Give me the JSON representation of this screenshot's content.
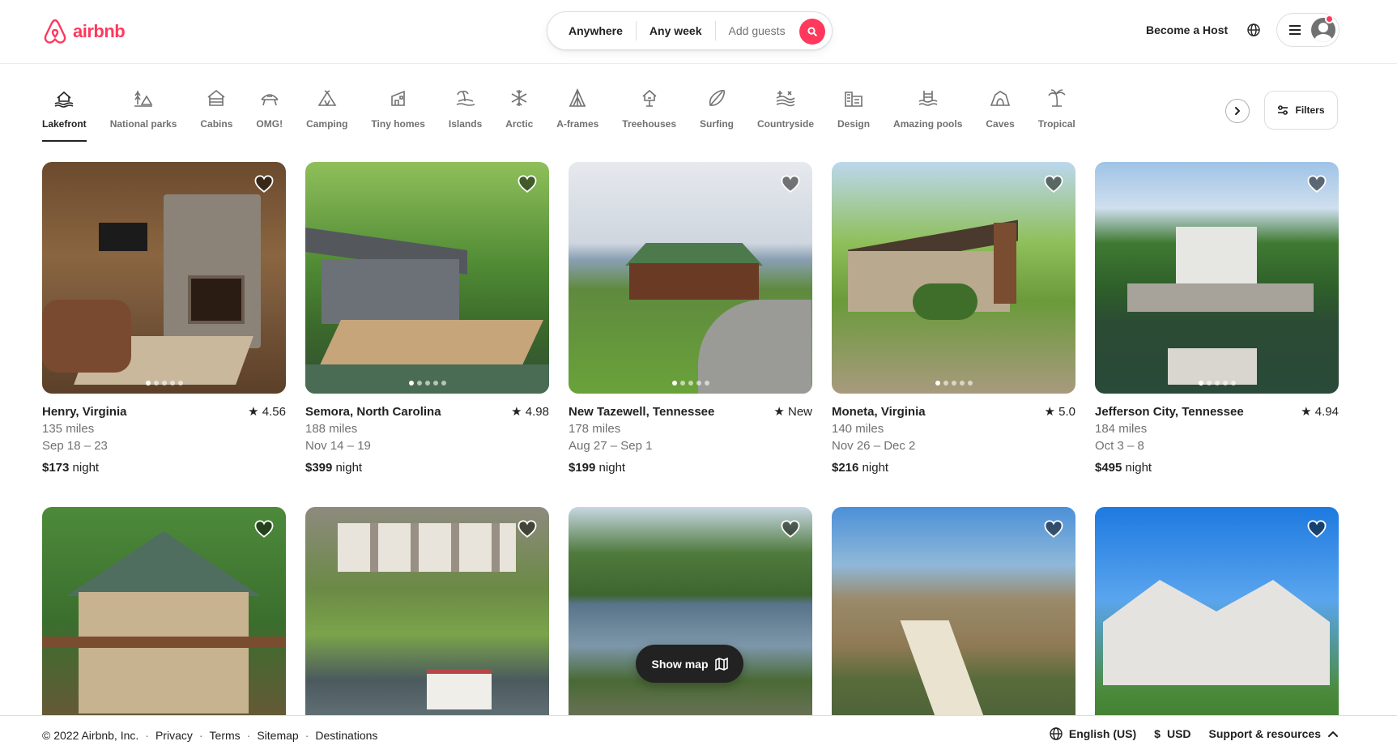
{
  "brand": {
    "name": "airbnb",
    "color": "#FF385C"
  },
  "search": {
    "where": "Anywhere",
    "when": "Any week",
    "guests_placeholder": "Add guests",
    "button_icon": "search-icon"
  },
  "header": {
    "host_link": "Become a Host",
    "language_icon": "globe-icon",
    "menu_icon": "hamburger-icon",
    "avatar_icon": "user-avatar-icon"
  },
  "categories": [
    {
      "label": "Lakefront",
      "icon": "lakefront-icon",
      "active": true
    },
    {
      "label": "National parks",
      "icon": "national-parks-icon"
    },
    {
      "label": "Cabins",
      "icon": "cabins-icon"
    },
    {
      "label": "OMG!",
      "icon": "omg-icon"
    },
    {
      "label": "Camping",
      "icon": "camping-icon"
    },
    {
      "label": "Tiny homes",
      "icon": "tiny-homes-icon"
    },
    {
      "label": "Islands",
      "icon": "islands-icon"
    },
    {
      "label": "Arctic",
      "icon": "snowflake-icon"
    },
    {
      "label": "A-frames",
      "icon": "a-frame-icon"
    },
    {
      "label": "Treehouses",
      "icon": "treehouse-icon"
    },
    {
      "label": "Surfing",
      "icon": "surfboard-icon"
    },
    {
      "label": "Countryside",
      "icon": "countryside-icon"
    },
    {
      "label": "Design",
      "icon": "design-icon"
    },
    {
      "label": "Amazing pools",
      "icon": "pool-icon"
    },
    {
      "label": "Caves",
      "icon": "cave-icon"
    },
    {
      "label": "Tropical",
      "icon": "palm-tree-icon"
    }
  ],
  "filters": {
    "label": "Filters",
    "icon": "filters-icon"
  },
  "listings": [
    {
      "location": "Henry, Virginia",
      "rating": "4.56",
      "distance": "135 miles",
      "dates": "Sep 18 – 23",
      "price": "$173",
      "unit": "night"
    },
    {
      "location": "Semora, North Carolina",
      "rating": "4.98",
      "distance": "188 miles",
      "dates": "Nov 14 – 19",
      "price": "$399",
      "unit": "night"
    },
    {
      "location": "New Tazewell, Tennessee",
      "rating": "New",
      "distance": "178 miles",
      "dates": "Aug 27 – Sep 1",
      "price": "$199",
      "unit": "night"
    },
    {
      "location": "Moneta, Virginia",
      "rating": "5.0",
      "distance": "140 miles",
      "dates": "Nov 26 – Dec 2",
      "price": "$216",
      "unit": "night"
    },
    {
      "location": "Jefferson City, Tennessee",
      "rating": "4.94",
      "distance": "184 miles",
      "dates": "Oct 3 – 8",
      "price": "$495",
      "unit": "night"
    },
    {
      "location": "",
      "rating": "",
      "distance": "",
      "dates": "",
      "price": "",
      "unit": ""
    },
    {
      "location": "",
      "rating": "",
      "distance": "",
      "dates": "",
      "price": "",
      "unit": ""
    },
    {
      "location": "",
      "rating": "",
      "distance": "",
      "dates": "",
      "price": "",
      "unit": ""
    },
    {
      "location": "",
      "rating": "",
      "distance": "",
      "dates": "",
      "price": "",
      "unit": ""
    },
    {
      "location": "",
      "rating": "",
      "distance": "",
      "dates": "",
      "price": "",
      "unit": ""
    }
  ],
  "show_map": {
    "label": "Show map",
    "icon": "map-icon"
  },
  "footer": {
    "copyright": "© 2022 Airbnb, Inc.",
    "links": [
      "Privacy",
      "Terms",
      "Sitemap",
      "Destinations"
    ],
    "language": "English (US)",
    "currency_symbol": "$",
    "currency": "USD",
    "support": "Support & resources"
  }
}
